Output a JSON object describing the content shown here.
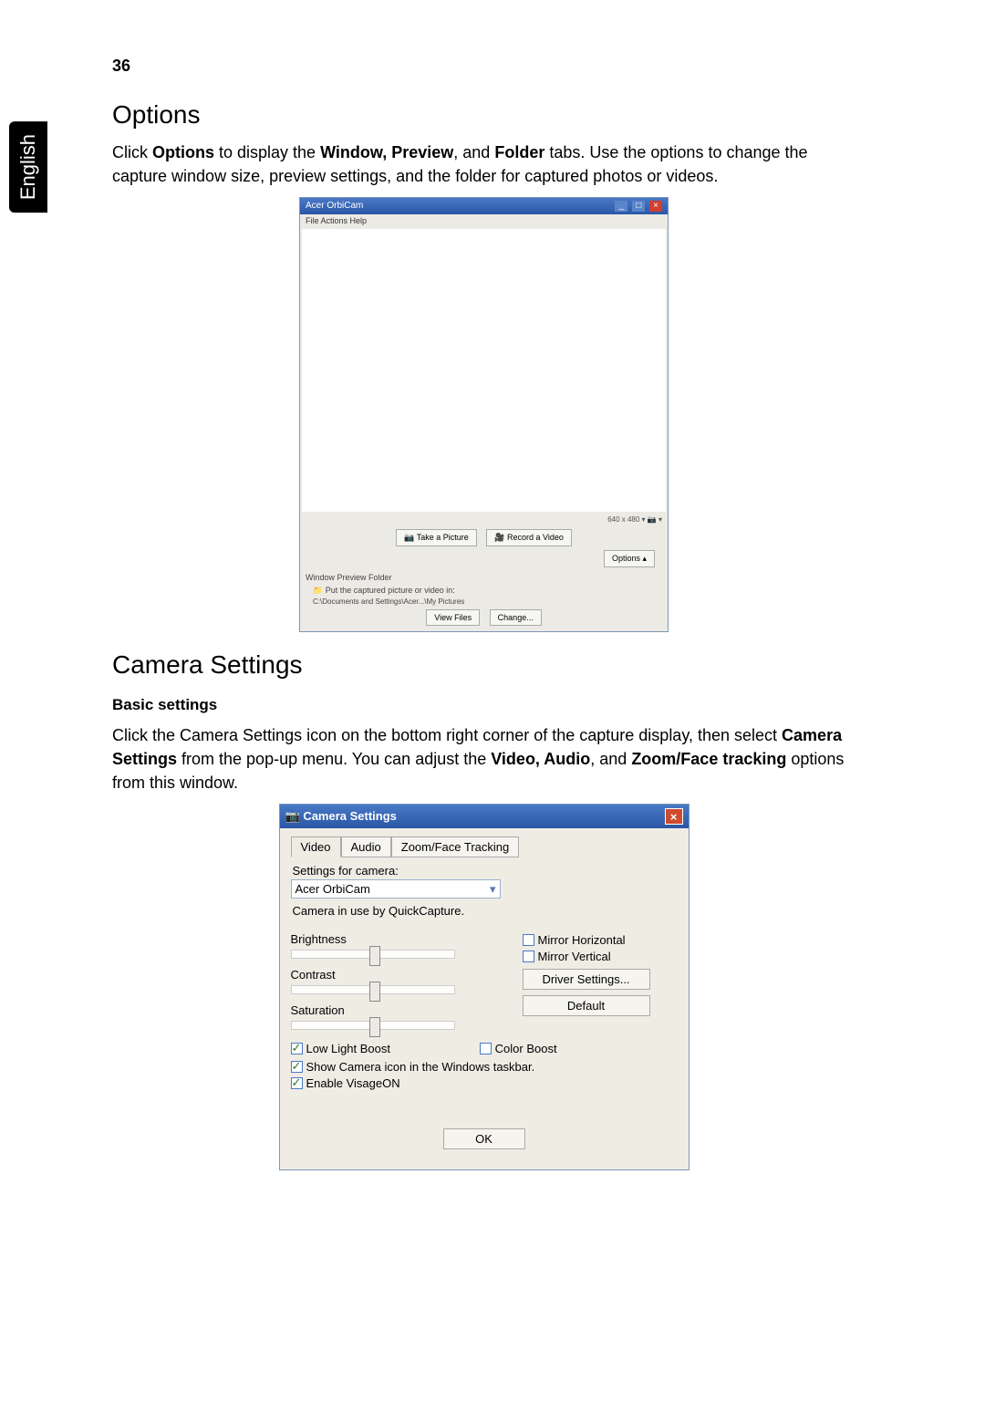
{
  "page_number": "36",
  "side_tab": "English",
  "section1": {
    "heading": "Options",
    "para_prefix": "Click ",
    "bold1": "Options",
    "para_mid1": " to display the ",
    "bold2": "Window, Preview",
    "para_mid2": ", and ",
    "bold3": "Folder",
    "para_suffix": " tabs. Use the options to change the capture window size, preview settings, and the folder for captured photos or videos."
  },
  "orbicam": {
    "title": "Acer OrbiCam",
    "menu": "File   Actions   Help",
    "status": "640 x 480 ▾   📷 ▾",
    "btn_take": "Take a Picture",
    "btn_record": "Record a Video",
    "btn_options": "Options  ▴",
    "tabs": "Window   Preview   Folder",
    "folder_msg": "Put the captured picture or video in:",
    "folder_path": "C:\\Documents and Settings\\Acer...\\My Pictures",
    "btn_view": "View Files",
    "btn_change": "Change..."
  },
  "section2": {
    "heading": "Camera Settings",
    "subhead": "Basic settings",
    "p1_prefix": "Click the Camera Settings icon on the bottom right corner of the capture display, then select ",
    "p1_bold1": "Camera Settings",
    "p1_mid": " from the pop-up menu. You can adjust the ",
    "p1_bold2": "Video, Audio",
    "p1_mid2": ", and ",
    "p1_bold3": "Zoom/Face tracking",
    "p1_suffix": " options from this window."
  },
  "camset": {
    "title": "Camera Settings",
    "tab_video": "Video",
    "tab_audio": "Audio",
    "tab_zoom": "Zoom/Face Tracking",
    "label_settings_for": "Settings for camera:",
    "camera_name": "Acer OrbiCam",
    "in_use": "Camera in use by QuickCapture.",
    "brightness": "Brightness",
    "contrast": "Contrast",
    "saturation": "Saturation",
    "mirror_h": "Mirror Horizontal",
    "mirror_v": "Mirror Vertical",
    "driver_btn": "Driver Settings...",
    "default_btn": "Default",
    "low_light": "Low Light Boost",
    "color_boost": "Color Boost",
    "show_icon": "Show Camera icon in the Windows taskbar.",
    "enable_visage": "Enable VisageON",
    "ok": "OK"
  }
}
